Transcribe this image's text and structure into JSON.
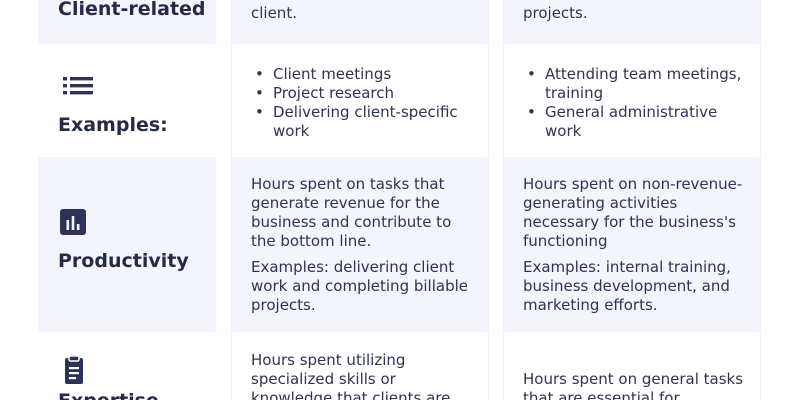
{
  "rows": {
    "client_related": {
      "label": "Client-related",
      "billable_text": "client.",
      "nonbillable_text": "projects."
    },
    "examples": {
      "label": "Examples:",
      "icon": "list-icon",
      "billable_items": [
        "Client meetings",
        "Project research",
        "Delivering client-specific work"
      ],
      "nonbillable_items": [
        "Attending team meetings, training",
        "General administrative work"
      ]
    },
    "productivity": {
      "label": "Productivity",
      "icon": "bar-chart-icon",
      "billable_desc": "Hours spent on tasks that generate revenue for the business and contribute to the bottom line.",
      "billable_examples": "Examples: delivering client work and completing billable projects.",
      "nonbillable_desc": "Hours spent on non-revenue-generating activities necessary for the business's functioning",
      "nonbillable_examples": "Examples: internal training, business development, and marketing efforts."
    },
    "expertise": {
      "label": "Expertise",
      "icon": "clipboard-icon",
      "billable_desc": "Hours spent utilizing specialized skills or knowledge that clients are",
      "nonbillable_desc": "Hours spent on general tasks that are essential for"
    }
  },
  "colors": {
    "shaded_cell": "#f3f4fc",
    "label_text": "#252b47",
    "body_text": "#2e3452",
    "icon": "#2c3356"
  }
}
